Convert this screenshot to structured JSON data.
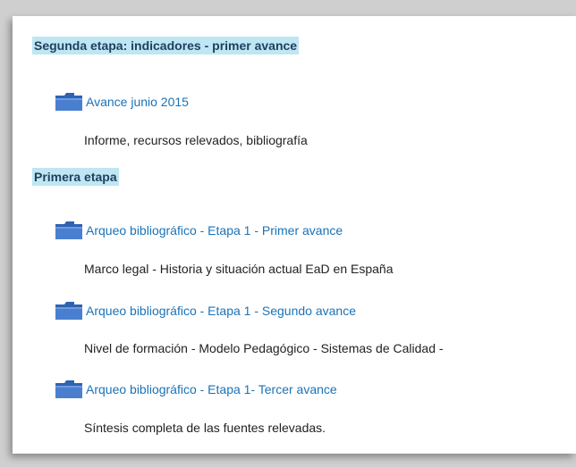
{
  "sections": [
    {
      "heading": "Segunda etapa: indicadores -  primer avance",
      "items": [
        {
          "icon": "folder-icon",
          "link": "Avance junio 2015",
          "description": "Informe, recursos relevados, bibliografía"
        }
      ]
    },
    {
      "heading": "Primera etapa",
      "items": [
        {
          "icon": "folder-icon",
          "link": "Arqueo bibliográfico - Etapa 1 - Primer avance",
          "description": "Marco legal - Historia y situación actual EaD en España"
        },
        {
          "icon": "folder-icon",
          "link": "Arqueo bibliográfico - Etapa 1 - Segundo avance",
          "description": "Nivel de formación - Modelo Pedagógico - Sistemas de Calidad -"
        },
        {
          "icon": "folder-icon",
          "link": "Arqueo bibliográfico - Etapa 1- Tercer avance",
          "description": "Síntesis completa de las fuentes relevadas."
        }
      ]
    }
  ],
  "colors": {
    "heading_bg": "#bfe6f3",
    "link": "#1a73b7",
    "folder": "#4a7fd0"
  }
}
